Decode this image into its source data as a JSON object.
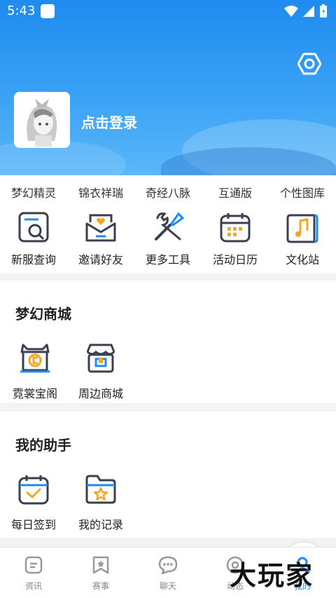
{
  "status_bar": {
    "time": "5:43"
  },
  "profile": {
    "login_text": "点击登录"
  },
  "shortcuts_text": [
    "梦幻精灵",
    "锦衣祥瑞",
    "奇经八脉",
    "互通版",
    "个性图库"
  ],
  "tools": [
    {
      "label": "新服查询",
      "icon": "search-server-icon"
    },
    {
      "label": "邀请好友",
      "icon": "invite-envelope-icon"
    },
    {
      "label": "更多工具",
      "icon": "tools-icon"
    },
    {
      "label": "活动日历",
      "icon": "calendar-icon"
    },
    {
      "label": "文化站",
      "icon": "music-scroll-icon"
    }
  ],
  "mall": {
    "title": "梦幻商城",
    "items": [
      {
        "label": "霓裳宝阁",
        "icon": "treasure-shop-icon"
      },
      {
        "label": "周边商城",
        "icon": "store-icon"
      }
    ]
  },
  "assistant": {
    "title": "我的助手",
    "items": [
      {
        "label": "每日签到",
        "icon": "calendar-check-icon"
      },
      {
        "label": "我的记录",
        "icon": "folder-star-icon"
      }
    ]
  },
  "bottom_nav": [
    {
      "label": "资讯",
      "icon": "news-icon"
    },
    {
      "label": "赛事",
      "icon": "bookmark-star-icon"
    },
    {
      "label": "聊天",
      "icon": "chat-icon"
    },
    {
      "label": "动态",
      "icon": "moments-icon"
    },
    {
      "label": "我的",
      "icon": "profile-icon",
      "active": true
    }
  ],
  "watermark": "大玩家",
  "colors": {
    "primary_blue": "#1a8cff",
    "accent_orange": "#f5a623",
    "icon_dark": "#3a3f4d"
  }
}
